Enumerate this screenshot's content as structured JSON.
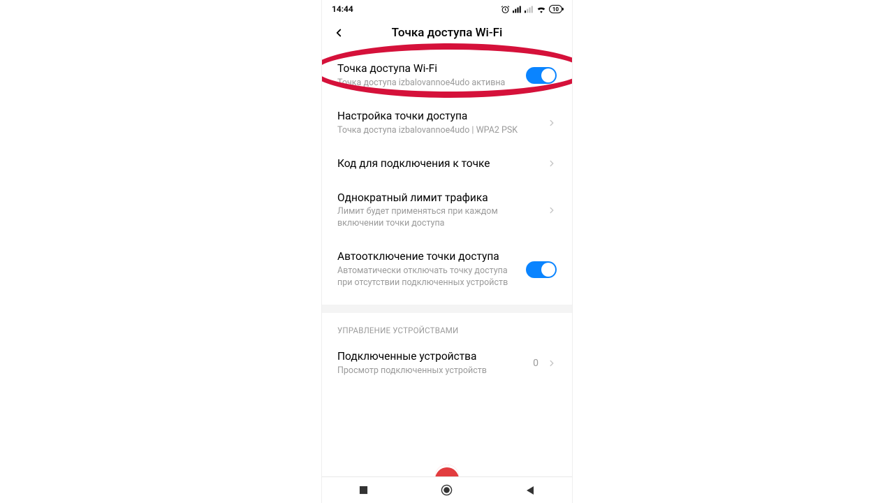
{
  "status": {
    "time": "14:44",
    "battery": "10"
  },
  "header": {
    "title": "Точка доступа Wi-Fi"
  },
  "rows": {
    "hotspot": {
      "title": "Точка доступа Wi-Fi",
      "sub": "Точка доступа izbalovannoe4udo активна"
    },
    "config": {
      "title": "Настройка точки доступа",
      "sub": "Точка доступа izbalovannoe4udo | WPA2 PSK"
    },
    "qrcode": {
      "title": "Код для подключения к точке"
    },
    "limit": {
      "title": "Однократный лимит трафика",
      "sub": "Лимит будет применяться при каждом включении точки доступа"
    },
    "autoff": {
      "title": "Автоотключение точки доступа",
      "sub": "Автоматически отключать точку доступа при отсутствии подключенных устройств"
    },
    "connected": {
      "title": "Подключенные устройства",
      "sub": "Просмотр подключенных устройств",
      "value": "0"
    }
  },
  "section": {
    "devices": "УПРАВЛЕНИЕ УСТРОЙСТВАМИ"
  }
}
